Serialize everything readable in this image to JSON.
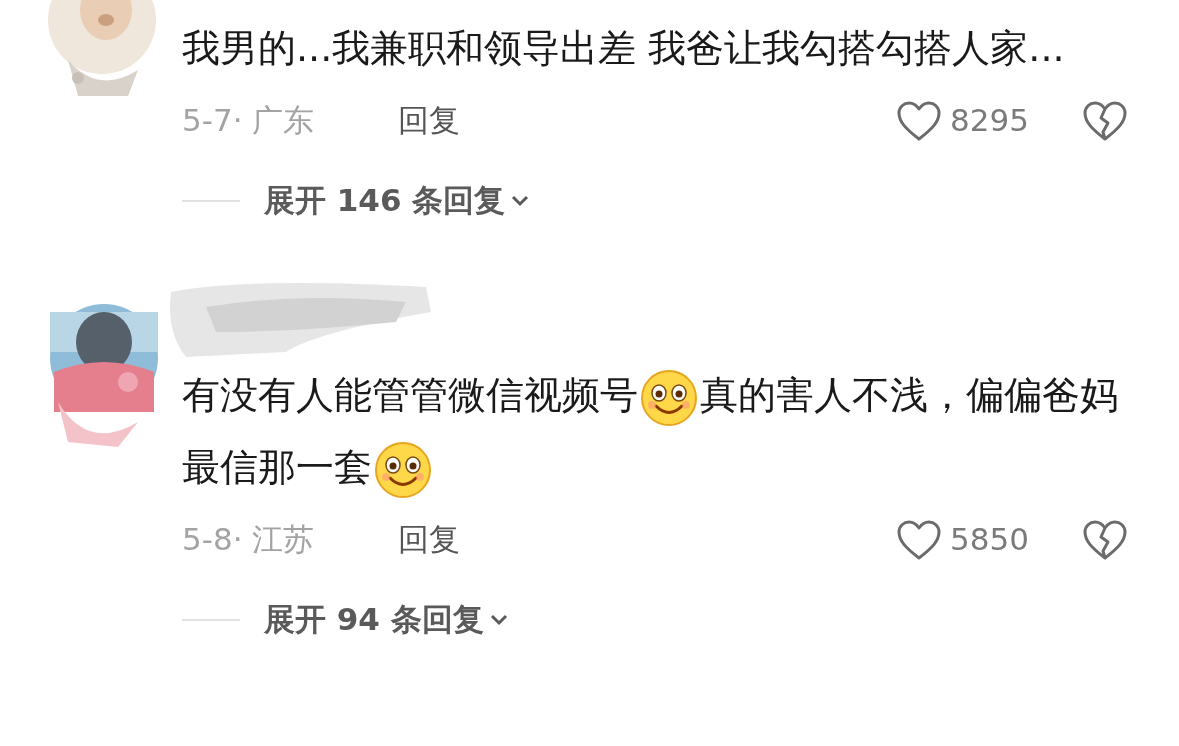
{
  "comments": [
    {
      "redacted_name": false,
      "content": [
        {
          "kind": "text",
          "text": "我男的...我兼职和领导出差 我爸让我勾搭勾搭人家..."
        }
      ],
      "date": "5-7· 广东",
      "reply": "回复",
      "likes": "8295",
      "expand": "展开 146 条回复"
    },
    {
      "redacted_name": true,
      "content": [
        {
          "kind": "text",
          "text": "有没有人能管管微信视频号"
        },
        {
          "kind": "emoji"
        },
        {
          "kind": "text",
          "text": "真的害人不浅，偏偏爸妈最信那一套"
        },
        {
          "kind": "emoji"
        }
      ],
      "date": "5-8· 江苏",
      "reply": "回复",
      "likes": "5850",
      "expand": "展开 94 条回复"
    }
  ]
}
